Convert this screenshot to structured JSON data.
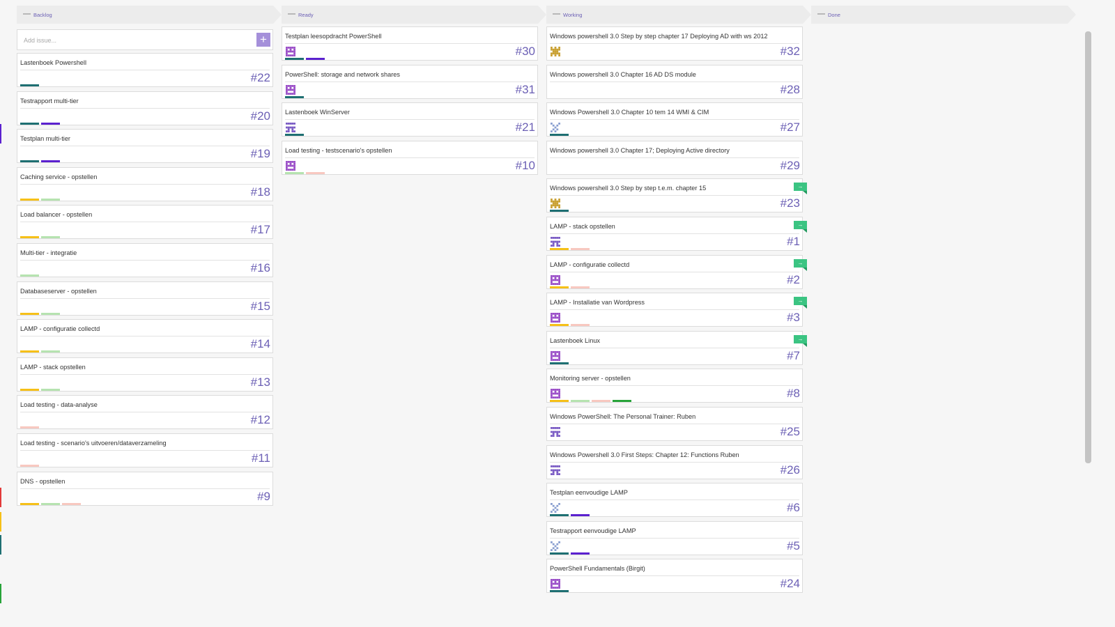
{
  "colors": {
    "accent": "#6c60b5",
    "label_teal": "#1e6f72",
    "label_purple": "#5b21cf",
    "label_yellow": "#f6c018",
    "label_lightgreen": "#b6e3b0",
    "label_pink": "#f8c8c0",
    "label_green": "#27a339",
    "flag_green": "#3bc482"
  },
  "columns": [
    {
      "title": "Backlog",
      "add_issue_placeholder": "Add issue...",
      "add_button_icon": "plus-icon",
      "cards": [
        {
          "title": "Lastenboek Powershell",
          "number": "#22",
          "avatar": null,
          "labels": [
            "teal"
          ],
          "flag": false
        },
        {
          "title": "Testrapport multi-tier",
          "number": "#20",
          "avatar": null,
          "labels": [
            "teal",
            "purple"
          ],
          "flag": false
        },
        {
          "title": "Testplan multi-tier",
          "number": "#19",
          "avatar": null,
          "labels": [
            "teal",
            "purple"
          ],
          "flag": false
        },
        {
          "title": "Caching service - opstellen",
          "number": "#18",
          "avatar": null,
          "labels": [
            "yellow",
            "lightgreen"
          ],
          "flag": false
        },
        {
          "title": "Load balancer - opstellen",
          "number": "#17",
          "avatar": null,
          "labels": [
            "yellow",
            "lightgreen"
          ],
          "flag": false
        },
        {
          "title": "Multi-tier - integratie",
          "number": "#16",
          "avatar": null,
          "labels": [
            "lightgreen"
          ],
          "flag": false
        },
        {
          "title": "Databaseserver - opstellen",
          "number": "#15",
          "avatar": null,
          "labels": [
            "yellow",
            "lightgreen"
          ],
          "flag": false
        },
        {
          "title": "LAMP - configuratie collectd",
          "number": "#14",
          "avatar": null,
          "labels": [
            "yellow",
            "lightgreen"
          ],
          "flag": false
        },
        {
          "title": "LAMP - stack opstellen",
          "number": "#13",
          "avatar": null,
          "labels": [
            "yellow",
            "lightgreen"
          ],
          "flag": false
        },
        {
          "title": "Load testing - data-analyse",
          "number": "#12",
          "avatar": null,
          "labels": [
            "pink"
          ],
          "flag": false
        },
        {
          "title": "Load testing - scenario's uitvoeren/dataverzameling",
          "number": "#11",
          "avatar": null,
          "labels": [
            "pink"
          ],
          "flag": false
        },
        {
          "title": "DNS - opstellen",
          "number": "#9",
          "avatar": null,
          "labels": [
            "yellow",
            "lightgreen",
            "pink"
          ],
          "flag": false
        }
      ]
    },
    {
      "title": "Ready",
      "cards": [
        {
          "title": "Testplan leesopdracht PowerShell",
          "number": "#30",
          "avatar": "purple-avatar",
          "labels": [
            "teal",
            "purple"
          ],
          "flag": false
        },
        {
          "title": "PowerShell: storage and network shares",
          "number": "#31",
          "avatar": "purple-avatar",
          "labels": [
            "teal"
          ],
          "flag": false
        },
        {
          "title": "Lastenboek WinServer",
          "number": "#21",
          "avatar": "violet-avatar",
          "labels": [
            "teal"
          ],
          "flag": false
        },
        {
          "title": "Load testing - testscenario's opstellen",
          "number": "#10",
          "avatar": "purple-avatar",
          "labels": [
            "lightgreen",
            "pink"
          ],
          "flag": false
        }
      ]
    },
    {
      "title": "Working",
      "cards": [
        {
          "title": "Windows powershell 3.0 Step by step chapter 17 Deploying AD with ws 2012",
          "number": "#32",
          "avatar": "gold-avatar",
          "labels": [],
          "flag": false
        },
        {
          "title": "Windows powershell 3.0 Chapter 16 AD DS module",
          "number": "#28",
          "avatar": null,
          "labels": [],
          "flag": false
        },
        {
          "title": "Windows Powershell 3.0 Chapter 10 tem 14 WMI & CIM",
          "number": "#27",
          "avatar": "blue-avatar",
          "labels": [
            "teal"
          ],
          "flag": false
        },
        {
          "title": "Windows powershell 3.0 Chapter 17; Deploying Active directory",
          "number": "#29",
          "avatar": null,
          "labels": [],
          "flag": false
        },
        {
          "title": "Windows powershell 3.0 Step by step t.e.m. chapter 15",
          "number": "#23",
          "avatar": "gold-avatar",
          "labels": [
            "teal"
          ],
          "flag": true
        },
        {
          "title": "LAMP - stack opstellen",
          "number": "#1",
          "avatar": "violet-avatar",
          "labels": [
            "yellow",
            "pink"
          ],
          "flag": true
        },
        {
          "title": "LAMP - configuratie collectd",
          "number": "#2",
          "avatar": "purple-avatar",
          "labels": [
            "yellow",
            "pink"
          ],
          "flag": true
        },
        {
          "title": "LAMP - Installatie van Wordpress",
          "number": "#3",
          "avatar": "purple-avatar",
          "labels": [
            "yellow",
            "pink"
          ],
          "flag": true
        },
        {
          "title": "Lastenboek Linux",
          "number": "#7",
          "avatar": "purple-avatar",
          "labels": [
            "teal"
          ],
          "flag": true
        },
        {
          "title": "Monitoring server - opstellen",
          "number": "#8",
          "avatar": "purple-avatar",
          "labels": [
            "yellow",
            "lightgreen",
            "pink",
            "green"
          ],
          "flag": false
        },
        {
          "title": "Windows PowerShell: The Personal Trainer: Ruben",
          "number": "#25",
          "avatar": "violet-avatar",
          "labels": [],
          "flag": false
        },
        {
          "title": "Windows Powershell 3.0 First Steps: Chapter 12: Functions Ruben",
          "number": "#26",
          "avatar": "violet-avatar",
          "labels": [],
          "flag": false
        },
        {
          "title": "Testplan eenvoudige LAMP",
          "number": "#6",
          "avatar": "blue-avatar",
          "labels": [
            "teal",
            "purple"
          ],
          "flag": false
        },
        {
          "title": "Testrapport eenvoudige LAMP",
          "number": "#5",
          "avatar": "blue-avatar",
          "labels": [
            "teal",
            "purple"
          ],
          "flag": false
        },
        {
          "title": "PowerShell Fundamentals (Birgit)",
          "number": "#24",
          "avatar": "purple-avatar",
          "labels": [
            "teal"
          ],
          "flag": false
        }
      ]
    },
    {
      "title": "Done",
      "cards": []
    }
  ]
}
